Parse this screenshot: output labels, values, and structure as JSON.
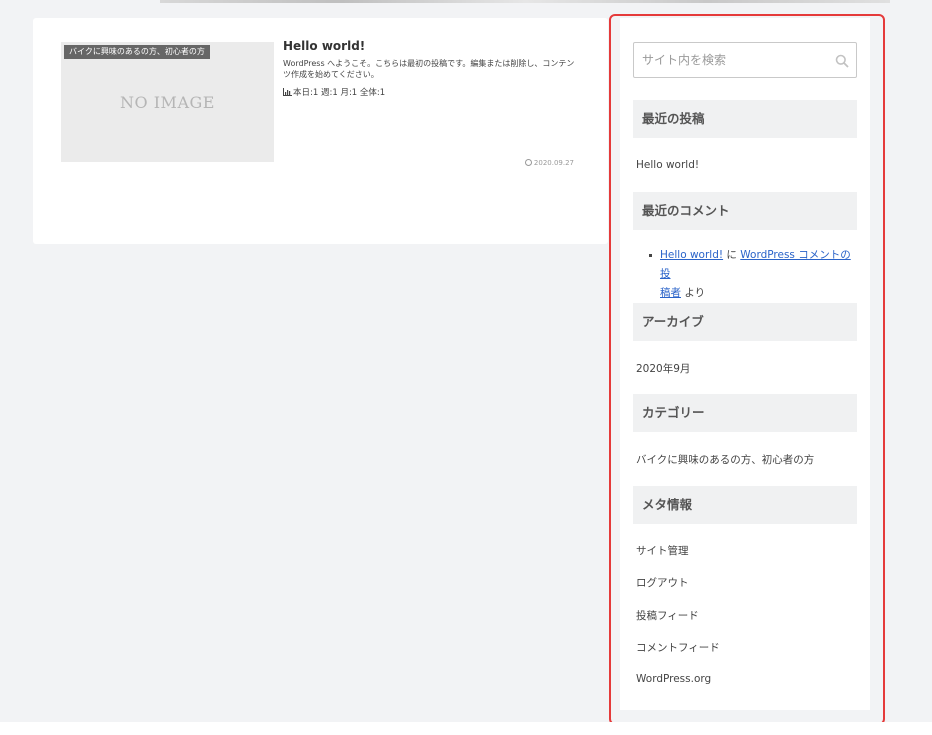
{
  "post": {
    "category_badge": "バイクに興味のあるの方、初心者の方",
    "thumbnail_placeholder": "NO IMAGE",
    "title": "Hello world!",
    "excerpt": "WordPress へようこそ。こちらは最初の投稿です。編集または削除し、コンテンツ作成を始めてください。",
    "stats": "本日:1  週:1  月:1  全体:1",
    "date": "2020.09.27"
  },
  "sidebar": {
    "search_placeholder": "サイト内を検索",
    "recent_posts": {
      "heading": "最近の投稿",
      "items": [
        "Hello world!"
      ]
    },
    "recent_comments": {
      "heading": "最近のコメント",
      "post_link": "Hello world!",
      "connector": "に",
      "author_link_line1": "WordPress コメントの投",
      "author_link_line2": "稿者",
      "suffix": "より"
    },
    "archives": {
      "heading": "アーカイブ",
      "items": [
        "2020年9月"
      ]
    },
    "categories": {
      "heading": "カテゴリー",
      "items": [
        "バイクに興味のあるの方、初心者の方"
      ]
    },
    "meta": {
      "heading": "メタ情報",
      "items": [
        "サイト管理",
        "ログアウト",
        "投稿フィード",
        "コメントフィード",
        "WordPress.org"
      ]
    }
  },
  "colors": {
    "highlight_outline": "#e53a3a",
    "link": "#2a63c9",
    "page_background": "#f2f3f5"
  }
}
